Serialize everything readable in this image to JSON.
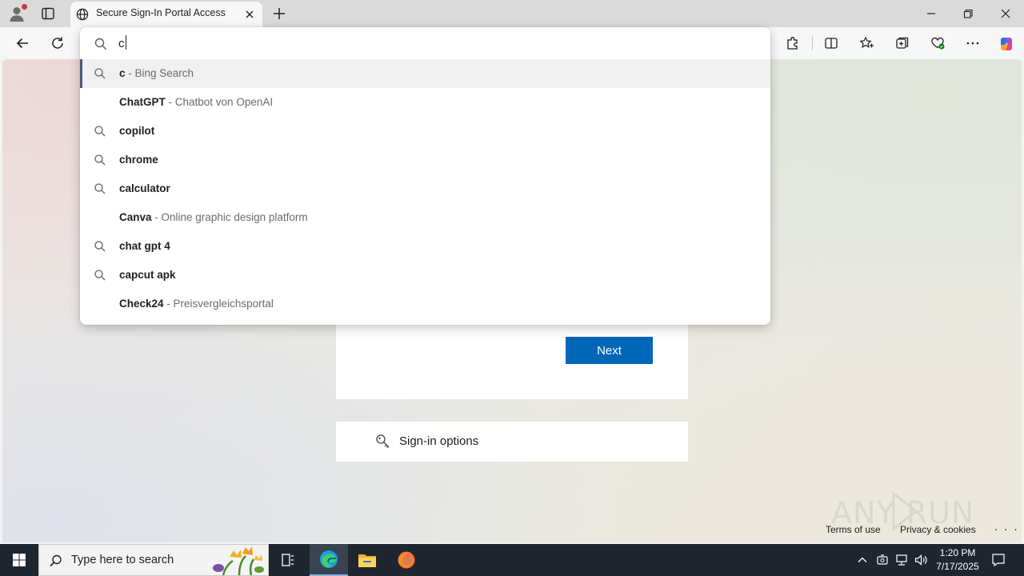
{
  "browser": {
    "tab": {
      "title": "Secure Sign-In Portal Access"
    }
  },
  "omnibox": {
    "value": "c",
    "suggestions": [
      {
        "type": "search",
        "bold": "c",
        "desc": " - Bing Search",
        "selected": true
      },
      {
        "type": "site",
        "bold": "ChatGPT",
        "desc": " - Chatbot von OpenAI"
      },
      {
        "type": "search",
        "bold": "copilot",
        "desc": ""
      },
      {
        "type": "search",
        "bold": "chrome",
        "desc": ""
      },
      {
        "type": "search",
        "bold": "calculator",
        "desc": ""
      },
      {
        "type": "site",
        "bold": "Canva",
        "desc": " - Online graphic design platform"
      },
      {
        "type": "search",
        "bold": "chat gpt 4",
        "desc": ""
      },
      {
        "type": "search",
        "bold": "capcut apk",
        "desc": ""
      },
      {
        "type": "site",
        "bold": "Check24",
        "desc": " - Preisvergleichsportal"
      }
    ]
  },
  "page": {
    "next_label": "Next",
    "signin_options_label": "Sign-in options",
    "footer": {
      "terms": "Terms of use",
      "privacy": "Privacy & cookies",
      "more": ". . ."
    },
    "watermark": "ANY RUN"
  },
  "taskbar": {
    "search_placeholder": "Type here to search",
    "time": "1:20 PM",
    "date": "7/17/2025"
  },
  "colors": {
    "accent": "#0067b8",
    "taskbar": "#1f2630",
    "selected_bar": "#4a5c7a"
  }
}
